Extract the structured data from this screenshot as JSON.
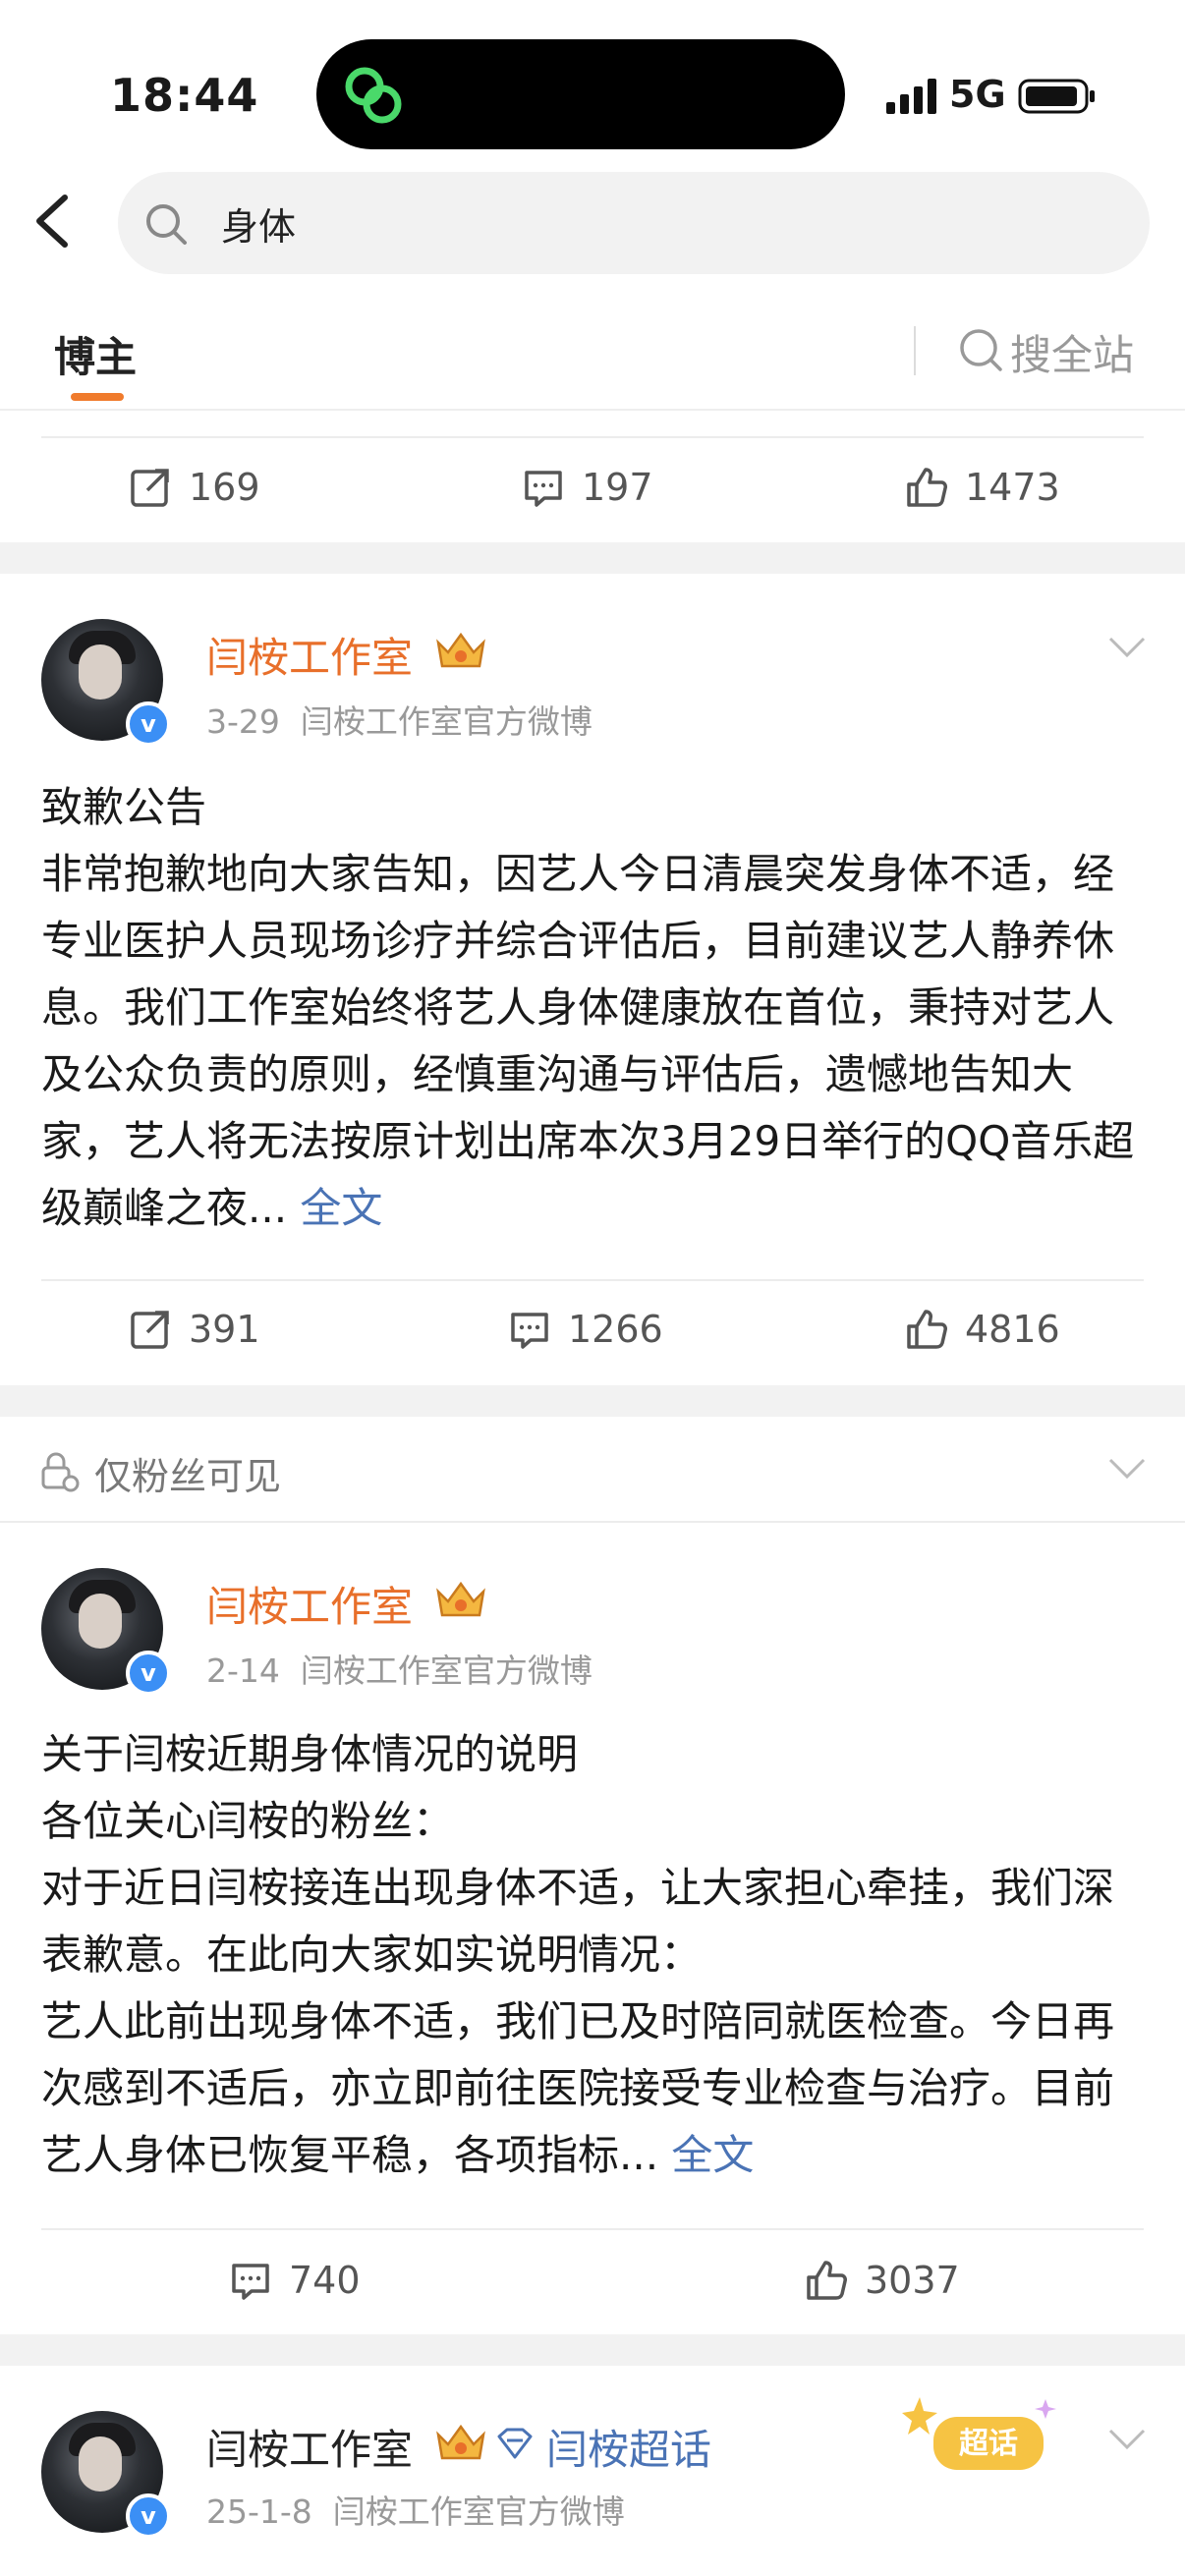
{
  "status_bar": {
    "time": "18:44",
    "network": "5G"
  },
  "search": {
    "query": "身体"
  },
  "tabs": {
    "active": "博主",
    "site_search": "搜全站"
  },
  "post0_actions": {
    "reposts": "169",
    "comments": "197",
    "likes": "1473"
  },
  "post1": {
    "author": "闫桉工作室",
    "date": "3-29",
    "source": "闫桉工作室官方微博",
    "text": "致歉公告\n非常抱歉地向大家告知，因艺人今日清晨突发身体不适，经专业医护人员现场诊疗并综合评估后，目前建议艺人静养休息。我们工作室始终将艺人身体健康放在首位，秉持对艺人及公众负责的原则，经慎重沟通与评估后，遗憾地告知大家，艺人将无法按原计划出席本次3月29日举行的QQ音乐超级巅峰之夜...",
    "full_text_link": "全文",
    "reposts": "391",
    "comments": "1266",
    "likes": "4816"
  },
  "post2": {
    "visibility": "仅粉丝可见",
    "author": "闫桉工作室",
    "date": "2-14",
    "source": "闫桉工作室官方微博",
    "text": "关于闫桉近期身体情况的说明\n各位关心闫桉的粉丝：\n对于近日闫桉接连出现身体不适，让大家担心牵挂，我们深表歉意。在此向大家如实说明情况：\n艺人此前出现身体不适，我们已及时陪同就医检查。今日再次感到不适后，亦立即前往医院接受专业检查与治疗。目前艺人身体已恢复平稳，各项指标...",
    "full_text_link": "全文",
    "comments": "740",
    "likes": "3037"
  },
  "post3": {
    "author": "闫桉工作室",
    "topic": "闫桉超话",
    "sticker": "超话",
    "date": "25-1-8",
    "source": "闫桉工作室官方微博"
  },
  "colors": {
    "accent": "#f07b2c",
    "author": "#e86f2a",
    "link": "#4a73b5",
    "verified": "#3b8ff5"
  }
}
